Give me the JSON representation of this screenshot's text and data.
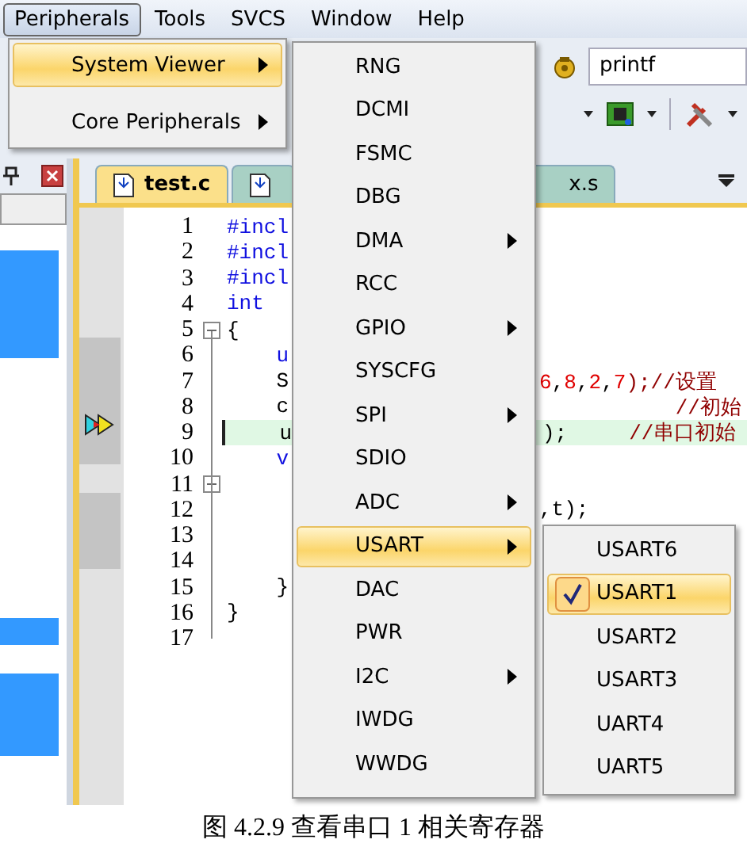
{
  "menu_bar": [
    {
      "label": "Peripherals",
      "selected": true
    },
    {
      "label": "Tools",
      "selected": false
    },
    {
      "label": "SVCS",
      "selected": false
    },
    {
      "label": "Window",
      "selected": false
    },
    {
      "label": "Help",
      "selected": false
    }
  ],
  "toolbar": {
    "search": {
      "value": "printf"
    }
  },
  "tabs": [
    {
      "label": "test.c",
      "selected": true
    },
    {
      "selected": false
    },
    {
      "label": "x.s",
      "selected": false
    }
  ],
  "editor": {
    "lines": [
      {
        "number": "1",
        "fold": false,
        "current": false,
        "left": [
          {
            "text": "#incl",
            "kind": "keyword"
          }
        ]
      },
      {
        "number": "2",
        "fold": false,
        "current": false,
        "left": [
          {
            "text": "#incl",
            "kind": "keyword"
          }
        ]
      },
      {
        "number": "3",
        "fold": false,
        "current": false,
        "left": [
          {
            "text": "#incl",
            "kind": "keyword"
          }
        ]
      },
      {
        "number": "4",
        "fold": false,
        "current": false,
        "left": [
          {
            "text": "int",
            "kind": "keyword"
          }
        ]
      },
      {
        "number": "5",
        "fold": true,
        "current": false,
        "left": [
          {
            "text": "{",
            "kind": "plain"
          }
        ]
      },
      {
        "number": "6",
        "fold": false,
        "current": false,
        "left": [
          {
            "text": "    u",
            "kind": "keyword"
          }
        ]
      },
      {
        "number": "7",
        "fold": false,
        "current": false,
        "left": [
          {
            "text": "    S",
            "kind": "plain"
          }
        ],
        "right": [
          {
            "text": "6",
            "kind": "number"
          },
          {
            "text": ",",
            "kind": "plain"
          },
          {
            "text": "8",
            "kind": "number"
          },
          {
            "text": ",",
            "kind": "plain"
          },
          {
            "text": "2",
            "kind": "number"
          },
          {
            "text": ",",
            "kind": "plain"
          },
          {
            "text": "7",
            "kind": "number"
          },
          {
            "text": ");//设置",
            "kind": "comment"
          }
        ]
      },
      {
        "number": "8",
        "fold": false,
        "current": false,
        "left": [
          {
            "text": "    c",
            "kind": "plain"
          }
        ],
        "right": [
          {
            "text": "           //初始",
            "kind": "comment"
          }
        ]
      },
      {
        "number": "9",
        "fold": false,
        "current": true,
        "left": [
          {
            "text": "    u",
            "kind": "plain"
          }
        ],
        "right": [
          {
            "text": ");     ",
            "kind": "plain"
          },
          {
            "text": "//串口初始",
            "kind": "comment"
          }
        ]
      },
      {
        "number": "10",
        "fold": false,
        "current": false,
        "left": [
          {
            "text": "    v",
            "kind": "keyword"
          }
        ]
      },
      {
        "number": "11",
        "fold": true,
        "current": false
      },
      {
        "number": "12",
        "fold": false,
        "current": false,
        "right": [
          {
            "text": ",t);",
            "kind": "plain"
          }
        ]
      },
      {
        "number": "13",
        "fold": false,
        "current": false
      },
      {
        "number": "14",
        "fold": false,
        "current": false
      },
      {
        "number": "15",
        "fold": false,
        "current": false,
        "left": [
          {
            "text": "    }",
            "kind": "plain"
          }
        ]
      },
      {
        "number": "16",
        "fold": false,
        "current": false,
        "left": [
          {
            "text": "}",
            "kind": "plain"
          }
        ]
      },
      {
        "number": "17",
        "fold": false,
        "current": false
      }
    ]
  },
  "menus": [
    {
      "items": [
        {
          "label": "System Viewer",
          "submenu": true,
          "selected": true
        },
        {
          "label": "Core Peripherals",
          "submenu": true,
          "selected": false
        }
      ]
    },
    {
      "items": [
        {
          "label": "RNG",
          "submenu": false,
          "selected": false
        },
        {
          "label": "DCMI",
          "submenu": false,
          "selected": false
        },
        {
          "label": "FSMC",
          "submenu": false,
          "selected": false
        },
        {
          "label": "DBG",
          "submenu": false,
          "selected": false
        },
        {
          "label": "DMA",
          "submenu": true,
          "selected": false
        },
        {
          "label": "RCC",
          "submenu": false,
          "selected": false
        },
        {
          "label": "GPIO",
          "submenu": true,
          "selected": false
        },
        {
          "label": "SYSCFG",
          "submenu": false,
          "selected": false
        },
        {
          "label": "SPI",
          "submenu": true,
          "selected": false
        },
        {
          "label": "SDIO",
          "submenu": false,
          "selected": false
        },
        {
          "label": "ADC",
          "submenu": true,
          "selected": false
        },
        {
          "label": "USART",
          "submenu": true,
          "selected": true
        },
        {
          "label": "DAC",
          "submenu": false,
          "selected": false
        },
        {
          "label": "PWR",
          "submenu": false,
          "selected": false
        },
        {
          "label": "I2C",
          "submenu": true,
          "selected": false
        },
        {
          "label": "IWDG",
          "submenu": false,
          "selected": false
        },
        {
          "label": "WWDG",
          "submenu": false,
          "selected": false
        }
      ]
    },
    {
      "items": [
        {
          "label": "USART6",
          "checked": false,
          "selected": false
        },
        {
          "label": "USART1",
          "checked": true,
          "selected": true
        },
        {
          "label": "USART2",
          "checked": false,
          "selected": false
        },
        {
          "label": "USART3",
          "checked": false,
          "selected": false
        },
        {
          "label": "UART4",
          "checked": false,
          "selected": false
        },
        {
          "label": "UART5",
          "checked": false,
          "selected": false
        }
      ]
    }
  ],
  "caption": "图 4.2.9 查看串口 1 相关寄存器"
}
